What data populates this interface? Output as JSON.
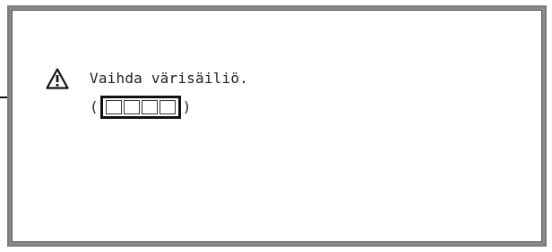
{
  "screen": {
    "message": "Vaihda värisäiliö.",
    "code_open": "(",
    "code_close": ")",
    "code_cells": [
      "",
      "",
      "",
      ""
    ],
    "icon": "warning-triangle-icon"
  },
  "colors": {
    "frame": "#8a8a8a",
    "screen_background": "#ffffff",
    "text": "#222222",
    "highlight_box": "#111111"
  }
}
